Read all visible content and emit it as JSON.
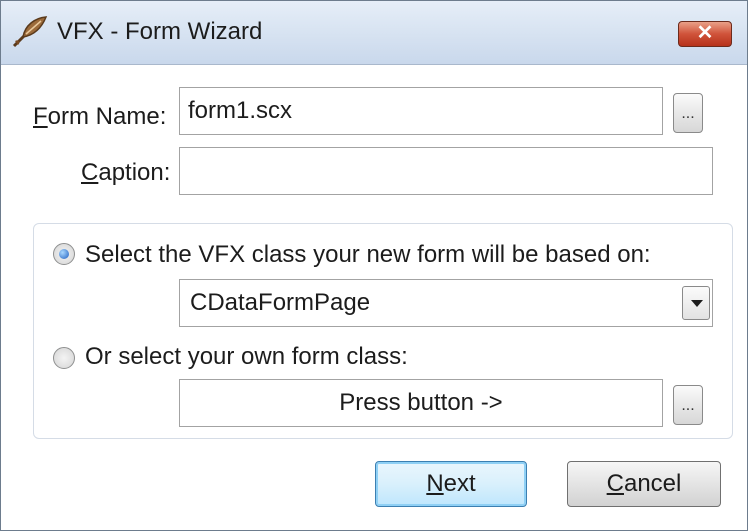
{
  "window": {
    "title": "VFX - Form Wizard",
    "close_glyph": "✕"
  },
  "form_name": {
    "label_accel": "F",
    "label_rest": "orm Name:",
    "value": "form1.scx",
    "browse_label": "..."
  },
  "caption": {
    "label_accel": "C",
    "label_rest": "aption:",
    "value": ""
  },
  "class_group": {
    "vfx_option": {
      "label": "Select the VFX class your new form will be based on:",
      "checked": true,
      "selected_class": "CDataFormPage"
    },
    "own_option": {
      "label": "Or select your own form class:",
      "checked": false,
      "field_text": "Press button ->",
      "browse_label": "..."
    }
  },
  "buttons": {
    "next_accel": "N",
    "next_rest": "ext",
    "cancel_accel": "C",
    "cancel_rest": "ancel"
  },
  "colors": {
    "titlebar": "#d6e2f1",
    "close_button": "#d0533a",
    "radio_checked": "#1e5ec0",
    "default_button_border": "#3c7fb1"
  },
  "icons": {
    "app": "feather-quill-icon",
    "close": "close-icon",
    "dropdown": "chevron-down-icon"
  }
}
